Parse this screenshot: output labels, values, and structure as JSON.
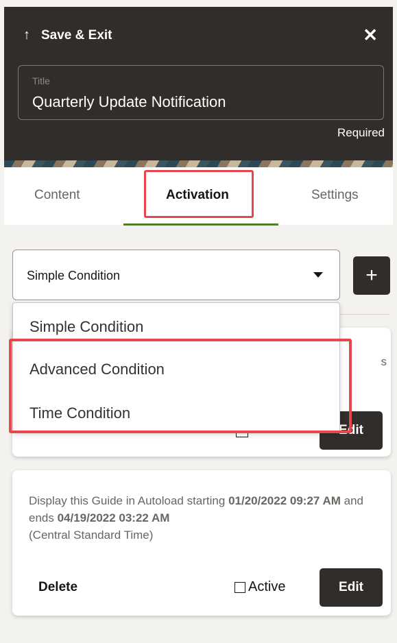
{
  "header": {
    "save_label": "Save & Exit",
    "save_icon": "up-arrow-icon",
    "close_glyph": "✕",
    "title_label": "Title",
    "title_value": "Quarterly Update Notification",
    "required_label": "Required"
  },
  "tabs": [
    {
      "label": "Content"
    },
    {
      "label": "Activation",
      "active": true
    },
    {
      "label": "Settings"
    }
  ],
  "condition_select": {
    "value": "Simple Condition",
    "options": [
      "Simple Condition",
      "Advanced Condition",
      "Time Condition"
    ]
  },
  "add_button_glyph": "+",
  "cards": [
    {
      "peek_text": "s",
      "edit_label": "Edit"
    },
    {
      "desc_prefix": "Display this Guide in Autoload starting ",
      "start": "01/20/2022 09:27 AM",
      "desc_mid": " and ends ",
      "end": "04/19/2022 03:22 AM",
      "timezone": "(Central Standard Time)",
      "delete_label": "Delete",
      "active_label": "Active",
      "edit_label": "Edit"
    }
  ],
  "colors": {
    "header_bg": "#312d2a",
    "highlight": "#e8454f",
    "tab_underline": "#4f7d2a"
  }
}
